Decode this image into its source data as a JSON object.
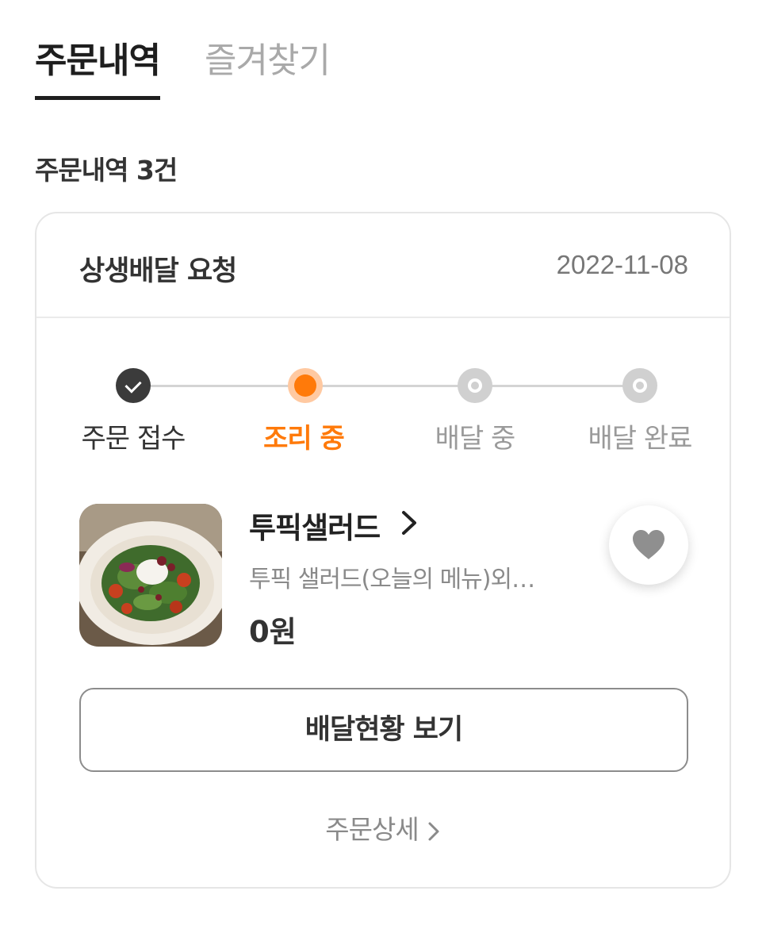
{
  "tabs": [
    {
      "label": "주문내역",
      "active": true
    },
    {
      "label": "즐겨찾기",
      "active": false
    }
  ],
  "order_count_label": "주문내역 3건",
  "order": {
    "title": "상생배달 요청",
    "date": "2022-11-08",
    "steps": [
      {
        "label": "주문 접수",
        "state": "done"
      },
      {
        "label": "조리 중",
        "state": "current"
      },
      {
        "label": "배달 중",
        "state": "pending"
      },
      {
        "label": "배달 완료",
        "state": "pending"
      }
    ],
    "store_name": "투픽샐러드",
    "menu_summary": "투픽 샐러드(오늘의 메뉴)외…",
    "price": "0원",
    "track_button": "배달현황 보기",
    "detail_link": "주문상세"
  },
  "colors": {
    "accent": "#ff7a0a",
    "text_dark": "#222222",
    "text_muted": "#8a8a8a",
    "border": "#e6e6e6"
  },
  "icons": {
    "step_done": "check-icon",
    "favorite": "heart-icon",
    "arrow": "chevron-right-icon"
  }
}
